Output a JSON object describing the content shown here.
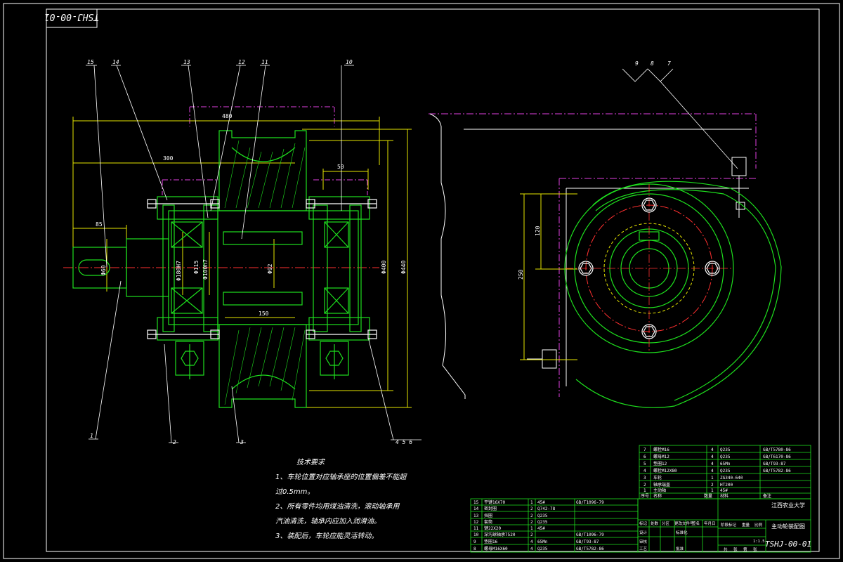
{
  "drawing": {
    "code_rotated": "TSHJ-00-01",
    "code": "TSHJ-00-01",
    "school": "江西农业大学",
    "drawing_title": "主动轮装配图",
    "scale": "1:1.5"
  },
  "balloons": {
    "top": [
      "15",
      "14",
      "13",
      "12",
      "11",
      "10"
    ],
    "top_right": [
      "9",
      "8",
      "7"
    ],
    "bottom": [
      "1",
      "2",
      "3",
      "4 5 6"
    ]
  },
  "dimensions": {
    "d480": "480",
    "d300": "300",
    "d85": "85",
    "d50": "50",
    "d150": "150",
    "d400": "Φ400",
    "d440": "Φ440",
    "d100": "Φ100h7",
    "d115": "Φ115",
    "d92": "Φ92",
    "d180": "Φ180H7",
    "d60": "Φ60",
    "v120": "120",
    "v250": "250"
  },
  "tech_notes": {
    "title": "技术要求",
    "line1": "1、车轮位置对应轴承座的位置偏差不能超",
    "line2": "过0.5mm。",
    "line3": "2、所有零件均用煤油清洗，滚动轴承用",
    "line4": "汽油清洗，轴承内应加入润滑油。",
    "line5": "3、装配后，车轮应能灵活转动。"
  },
  "upper_table": {
    "rows": [
      {
        "no": "7",
        "name": "螺栓M16",
        "qty": "4",
        "mat": "Q235",
        "std": "GB/T5780-86"
      },
      {
        "no": "6",
        "name": "螺母M12",
        "qty": "4",
        "mat": "Q235",
        "std": "GB/T6170-86"
      },
      {
        "no": "5",
        "name": "垫圈12",
        "qty": "4",
        "mat": "65Mn",
        "std": "GB/T93-87"
      },
      {
        "no": "4",
        "name": "螺栓M12X80",
        "qty": "4",
        "mat": "Q235",
        "std": "GB/T5782-86"
      },
      {
        "no": "3",
        "name": "车轮",
        "qty": "1",
        "mat": "ZG340-640",
        "std": ""
      },
      {
        "no": "2",
        "name": "轴承端盖",
        "qty": "2",
        "mat": "HT200",
        "std": ""
      },
      {
        "no": "1",
        "name": "主动轴",
        "qty": "1",
        "mat": "45#",
        "std": ""
      }
    ],
    "header": {
      "no": "序号",
      "name": "名称",
      "qty": "数量",
      "mat": "材料",
      "std": "备注"
    }
  },
  "lower_table": {
    "rows": [
      {
        "no": "15",
        "name": "平键16X70",
        "qty": "1",
        "mat": "45#",
        "std": "GB/T1096-79"
      },
      {
        "no": "14",
        "name": "密封圈",
        "qty": "2",
        "mat": "Q742-78",
        "std": ""
      },
      {
        "no": "13",
        "name": "挡圈",
        "qty": "2",
        "mat": "Q235",
        "std": ""
      },
      {
        "no": "12",
        "name": "套筒",
        "qty": "2",
        "mat": "Q235",
        "std": ""
      },
      {
        "no": "11",
        "name": "键22X20",
        "qty": "1",
        "mat": "45#",
        "std": ""
      },
      {
        "no": "10",
        "name": "深沟球轴承7520",
        "qty": "2",
        "mat": "",
        "std": "GB/T1096-79"
      },
      {
        "no": "9",
        "name": "垫圈16",
        "qty": "4",
        "mat": "65Mn",
        "std": "GB/T93-87"
      },
      {
        "no": "8",
        "name": "螺母M16X60",
        "qty": "4",
        "mat": "Q235",
        "std": "GB/T5782-86"
      }
    ]
  },
  "title_block": {
    "row1": [
      "标记",
      "处数",
      "分区",
      "更改文件号",
      "签名",
      "年月日"
    ],
    "row2": [
      "设计",
      "",
      "标准化",
      ""
    ],
    "labels": [
      "阶段标记",
      "重量",
      "比例"
    ],
    "row3": [
      "审核",
      ""
    ],
    "row4": [
      "工艺",
      "",
      "批准",
      ""
    ],
    "sheet": [
      "共",
      "张",
      "第",
      "张"
    ]
  }
}
